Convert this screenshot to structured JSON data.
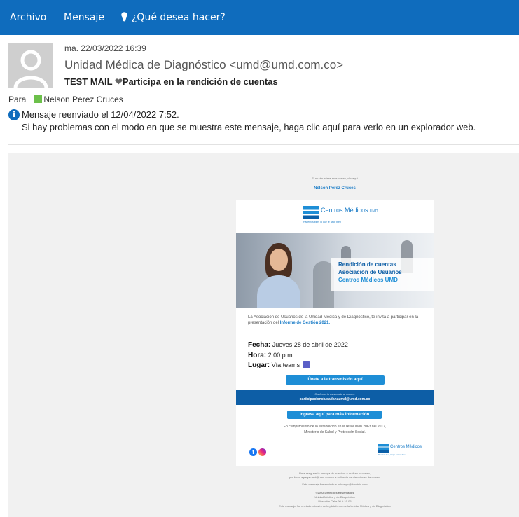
{
  "ribbon": {
    "archivo": "Archivo",
    "mensaje": "Mensaje",
    "lightbulb_glyph": "💡",
    "search_prompt": "¿Qué desea hacer?",
    "bg_color": "#0f6cbd"
  },
  "message": {
    "date": "ma. 22/03/2022 16:39",
    "from": "Unidad Médica de Diagnóstico <umd@umd.com.co>",
    "subject_prefix": "TEST MAIL ",
    "subject_heart": "❤",
    "subject_rest": "Participa en la rendición de cuentas",
    "to_label": "Para",
    "to_name": "Nelson Perez Cruces",
    "forwarded": "Mensaje reenviado el 12/04/2022 7:52.",
    "display_issue": "Si hay problemas con el modo en que se muestra este mensaje, haga clic aquí para verlo en un explorador web."
  },
  "email": {
    "top_note": "Si no visualizas este correo, clic aquí",
    "greeting": "Nelson Perez Cruces",
    "logo_text": "Centros Médicos",
    "logo_sub": "UMD",
    "slogan": "Hacemos bien, lo que te hace bien",
    "banner_line1": "Rendición de cuentas",
    "banner_line2": "Asociación de Usuarios",
    "banner_line3": "Centros Médicos UMD",
    "intro_text": "La Asociación de Usuarios de la Unidad Médica y de Diagnóstico, te invita a participar en la presentación del",
    "intro_link": "Informe de Gestión 2021.",
    "fecha_label": "Fecha:",
    "fecha_value": "Jueves 28 de abril de 2022",
    "hora_label": "Hora:",
    "hora_value": "2:00 p.m.",
    "lugar_label": "Lugar:",
    "lugar_value": "Vía teams",
    "join_button": "Únete a la transmisión aquí",
    "confirm_text": "Confirma tu asistencia al correo:",
    "confirm_email": "participacionciudadanaumd@umd.com.co",
    "info_button": "Ingresa aquí para más información",
    "compliance_1": "En cumplimiento de lo establecido en la resolución 2063 del 2017,",
    "compliance_2": "Ministerio de Salud y Protección Social.",
    "social_f": "f",
    "footer_1": "Para asegurar la entrega de nuestros e-mail en tu correo,",
    "footer_2": "por favor agrega umd@umd.com.co a tu libreta de direcciones de correo.",
    "footer_3": "Este mensaje fue enviado a nelsonpc@dominio.com",
    "footer_4": "©2022 Derechos Reservados",
    "footer_5": "Unidad Médica y de Diagnóstico",
    "footer_6": "Dirección Calle 90 # 19-05",
    "footer_7": "Este mensaje fue enviado a través de la plataforma de la Unidad Médica y de Diagnóstico"
  }
}
